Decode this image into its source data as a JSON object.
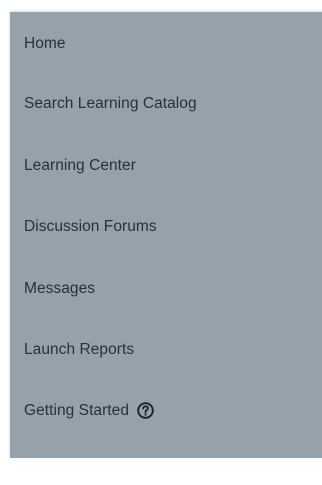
{
  "nav": {
    "items": [
      {
        "label": "Home"
      },
      {
        "label": "Search Learning Catalog"
      },
      {
        "label": "Learning Center"
      },
      {
        "label": "Discussion Forums"
      },
      {
        "label": "Messages"
      },
      {
        "label": "Launch Reports"
      },
      {
        "label": "Getting Started",
        "icon": "help-icon"
      }
    ]
  },
  "colors": {
    "panel_bg": "#95a2ac",
    "text": "#2c3035"
  }
}
